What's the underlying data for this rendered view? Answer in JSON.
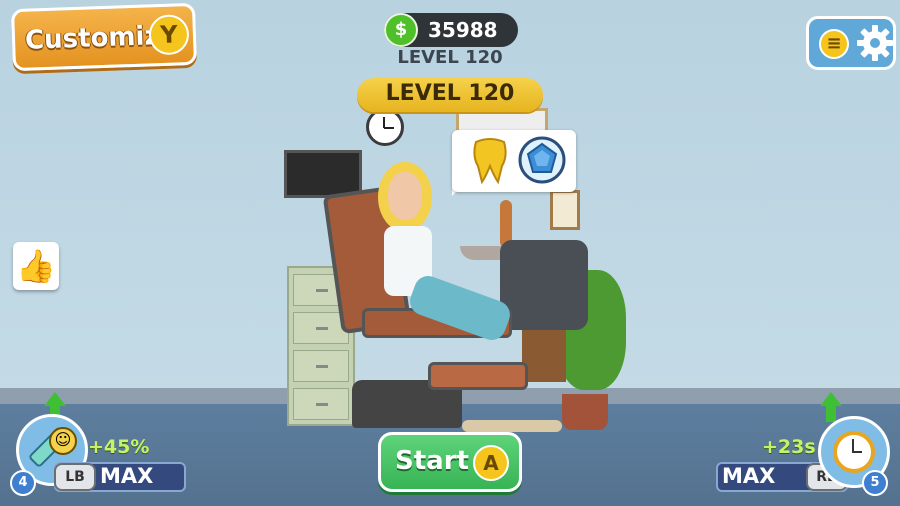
{
  "hud": {
    "customize_label": "Customize",
    "customize_key": "Y",
    "currency_symbol": "$",
    "money": "35988",
    "level_small": "LEVEL 120",
    "level_banner": "LEVEL 120",
    "menu_key": "≡",
    "start_label": "Start",
    "start_key": "A"
  },
  "upgrades": {
    "left": {
      "bonus": "+45%",
      "key": "LB",
      "value": "MAX",
      "count": "4"
    },
    "right": {
      "bonus": "+23s",
      "key": "RB",
      "value": "MAX",
      "count": "5"
    }
  },
  "icons": {
    "settings": "gear-icon",
    "like": "thumbs-up-icon",
    "treatment_1": "gold-tooth-icon",
    "treatment_2": "gem-icon",
    "left_upgrade": "syringe-smiley-icon",
    "right_upgrade": "stopwatch-icon"
  },
  "colors": {
    "customize_bg": "#f0a63a",
    "start_bg": "#4cc466",
    "level_banner": "#f2c83a",
    "money_bg": "#2f3438",
    "upgrade_bar": "#344a7e"
  }
}
